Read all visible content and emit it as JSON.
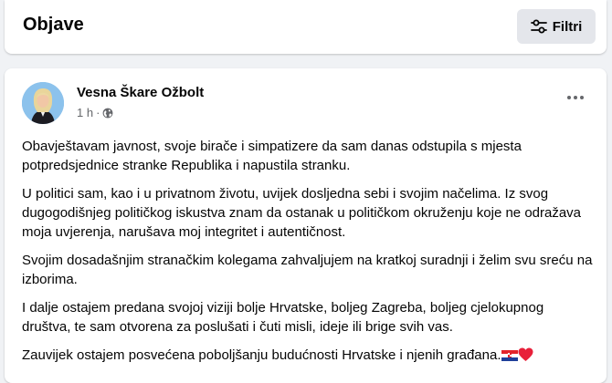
{
  "header": {
    "title": "Objave",
    "filter_label": "Filtri",
    "filter_icon": "sliders-icon"
  },
  "post": {
    "author": "Vesna Škare Ožbolt",
    "time": "1 h",
    "separator": "·",
    "privacy_icon": "globe-icon",
    "more_icon": "more-horizontal-icon",
    "paragraphs": [
      "Obavještavam javnost, svoje birače i simpatizere da sam danas odstupila s mjesta potpredsjednice stranke Republika i napustila stranku.",
      "U politici sam, kao i u privatnom životu, uvijek dosljedna sebi i svojim načelima. Iz svog dugogodišnjeg političkog iskustva znam da ostanak u političkom okruženju koje ne odražava moja uvjerenja, narušava moj integritet i autentičnost.",
      "Svojim dosadašnjim stranačkim kolegama zahvaljujem na kratkoj suradnji i želim svu sreću na izborima.",
      "I dalje ostajem predana svojoj viziji bolje Hrvatske, boljeg Zagreba, boljeg cjelokupnog društva, te sam otvorena za poslušati i čuti misli, ideje ili brige svih vas.",
      "Zauvijek ostajem posvećena poboljšanju budućnosti Hrvatske i njenih građana."
    ],
    "emojis": [
      "croatia-flag-emoji",
      "red-heart-emoji"
    ]
  }
}
